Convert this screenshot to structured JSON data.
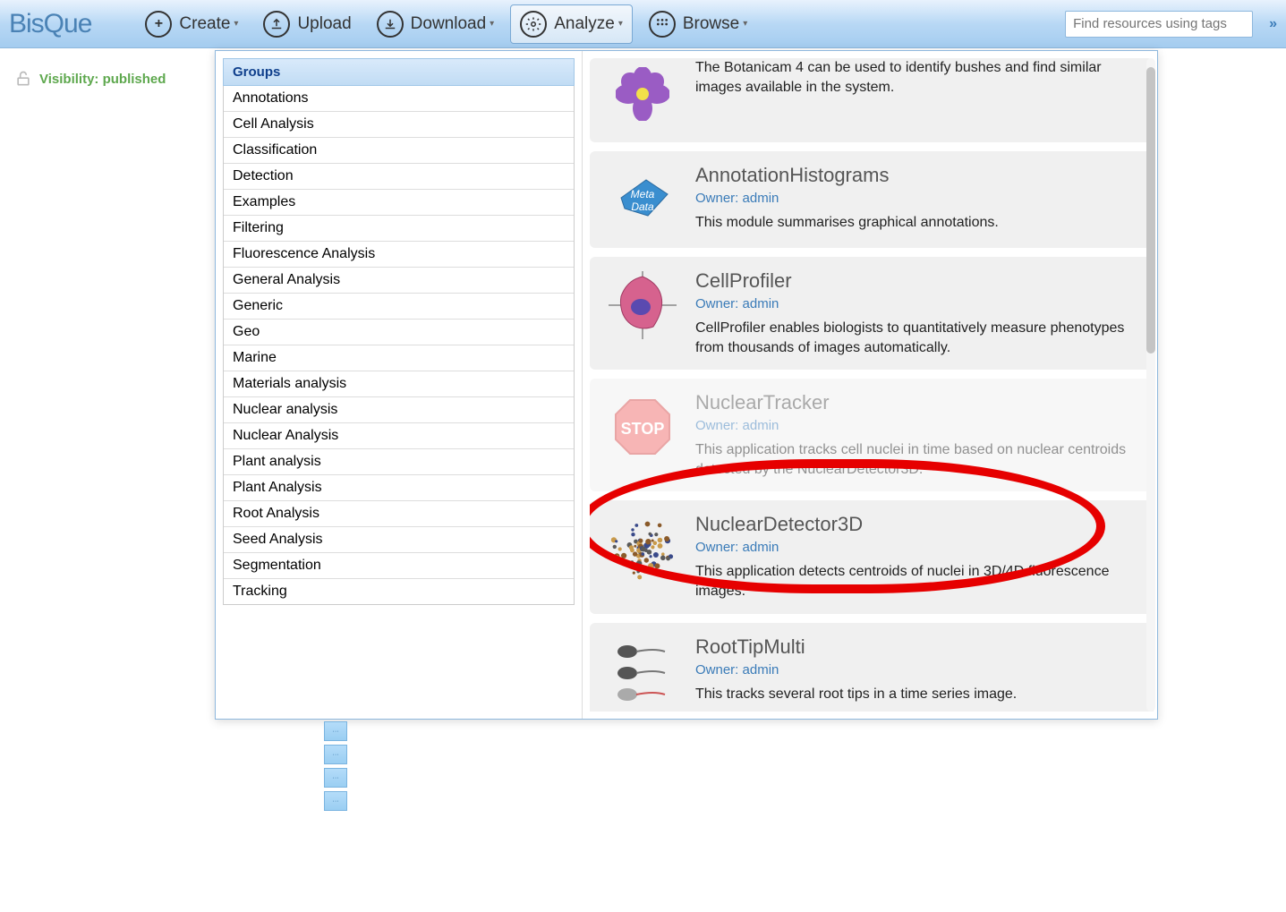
{
  "logo": "BisQue",
  "toolbar": {
    "create": "Create",
    "upload": "Upload",
    "download": "Download",
    "analyze": "Analyze",
    "browse": "Browse"
  },
  "search": {
    "placeholder": "Find resources using tags"
  },
  "visibility": {
    "label": "Visibility: published"
  },
  "groups": {
    "header": "Groups",
    "items": [
      "Annotations",
      "Cell Analysis",
      "Classification",
      "Detection",
      "Examples",
      "Filtering",
      "Fluorescence Analysis",
      "General Analysis",
      "Generic",
      "Geo",
      "Marine",
      "Materials analysis",
      "Nuclear analysis",
      "Nuclear Analysis",
      "Plant analysis",
      "Plant Analysis",
      "Root Analysis",
      "Seed Analysis",
      "Segmentation",
      "Tracking"
    ]
  },
  "modules": [
    {
      "title": "",
      "owner": "",
      "desc": "The Botanicam 4 can be used to identify bushes and find similar images available in the system.",
      "icon": "flower",
      "partial": true
    },
    {
      "title": "AnnotationHistograms",
      "owner": "Owner: admin",
      "desc": "This module summarises graphical annotations.",
      "icon": "metadata"
    },
    {
      "title": "CellProfiler",
      "owner": "Owner: admin",
      "desc": "CellProfiler enables biologists to quantitatively measure phenotypes from thousands of images automatically.",
      "icon": "cell",
      "circled": true
    },
    {
      "title": "NuclearTracker",
      "owner": "Owner: admin",
      "desc": "This application tracks cell nuclei in time based on nuclear centroids detected by the NuclearDetector3D.",
      "icon": "stop",
      "faded": true
    },
    {
      "title": "NuclearDetector3D",
      "owner": "Owner: admin",
      "desc": "This application detects centroids of nuclei in 3D/4D fluorescence images.",
      "icon": "nuclei"
    },
    {
      "title": "RootTipMulti",
      "owner": "Owner: admin",
      "desc": "This tracks several root tips in a time series image.",
      "icon": "roots"
    }
  ]
}
